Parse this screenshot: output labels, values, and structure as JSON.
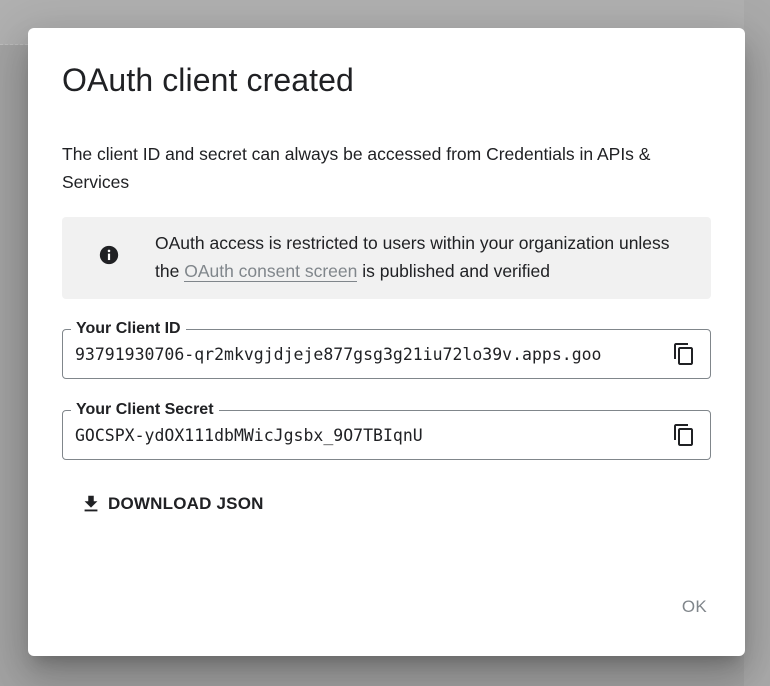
{
  "dialog": {
    "title": "OAuth client created",
    "description": "The client ID and secret can always be accessed from Credentials in APIs & Services",
    "notice": {
      "icon": "info-icon",
      "text_before": "OAuth access is restricted to users within your organization unless the ",
      "link_text": "OAuth consent screen",
      "text_after": " is published and verified"
    },
    "client_id": {
      "label": "Your Client ID",
      "value": "93791930706-qr2mkvgjdjeje877gsg3g21iu72lo39v.apps.goo",
      "copy_icon": "copy-icon"
    },
    "client_secret": {
      "label": "Your Client Secret",
      "value": "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",
      "copy_icon": "copy-icon"
    },
    "download": {
      "icon": "download-icon",
      "label": "DOWNLOAD JSON"
    },
    "ok_label": "OK"
  },
  "colors": {
    "text": "#202124",
    "muted": "#80868b",
    "notice_bg": "#f1f1f1",
    "overlay": "#a3a3a3"
  }
}
